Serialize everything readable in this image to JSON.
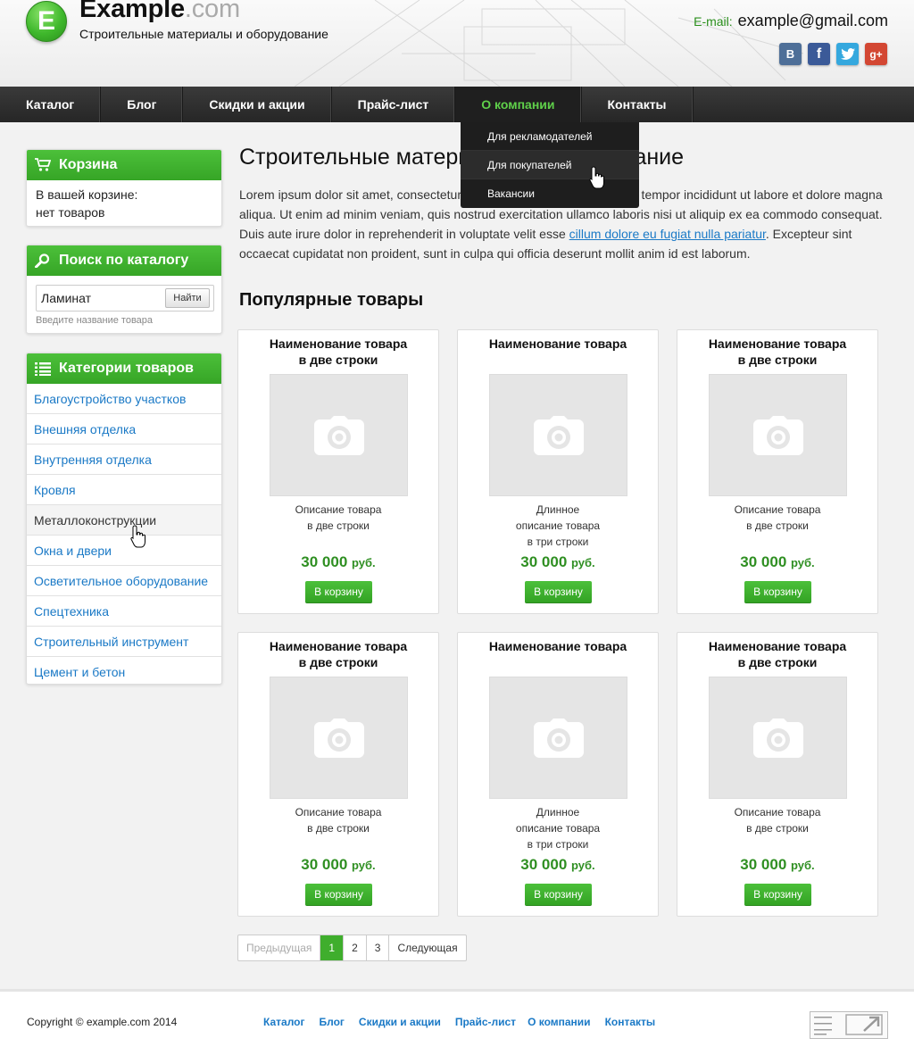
{
  "header": {
    "logo_letter": "E",
    "site_name": "Example",
    "site_domain": ".com",
    "tagline": "Строительные материалы и оборудование",
    "email_label": "E-mail:",
    "email": "example@gmail.com",
    "social": [
      "vk-icon",
      "facebook-icon",
      "twitter-icon",
      "google-plus-icon"
    ]
  },
  "nav": {
    "items": [
      "Каталог",
      "Блог",
      "Скидки и акции",
      "Прайс-лист",
      "О компании",
      "Контакты"
    ],
    "active": "О компании",
    "dropdown": [
      "Для рекламодателей",
      "Для покупателей",
      "Вакансии"
    ],
    "dropdown_hover": "Для покупателей"
  },
  "sidebar": {
    "cart": {
      "title": "Корзина",
      "line1": "В вашей корзине:",
      "line2": "нет товаров"
    },
    "search": {
      "title": "Поиск по каталогу",
      "value": "Ламинат",
      "button": "Найти",
      "hint": "Введите название товара"
    },
    "categories": {
      "title": "Категории товаров",
      "items": [
        "Благоустройство участков",
        "Внешняя отделка",
        "Внутренняя отделка",
        "Кровля",
        "Металлоконструкции",
        "Окна и двери",
        "Осветительное оборудование",
        "Спецтехника",
        "Строительный инструмент",
        "Цемент и бетон"
      ],
      "hover": "Металлоконструкции"
    }
  },
  "main": {
    "title": "Строительные материалы и оборудование",
    "intro_before": "Lorem ipsum dolor sit amet, consectetur adipisicing elit, sed do eiusmod tempor incididunt ut labore et dolore magna aliqua. Ut enim ad minim veniam, quis nostrud exercitation ullamco laboris nisi ut aliquip ex ea commodo consequat. Duis aute irure dolor in reprehenderit in voluptate velit esse ",
    "intro_link": "cillum dolore eu fugiat nulla pariatur",
    "intro_after": ". Excepteur sint occaecat cupidatat non proident, sunt in culpa qui officia deserunt mollit anim id est laborum.",
    "popular_title": "Популярные товары",
    "products": [
      {
        "title": "Наименование товара\nв две строки",
        "desc": "Описание товара\nв две строки",
        "price": "30 000",
        "currency": "руб.",
        "button": "В корзину"
      },
      {
        "title": "Наименование товара",
        "desc": "Длинное\nописание товара\nв три строки",
        "price": "30 000",
        "currency": "руб.",
        "button": "В корзину"
      },
      {
        "title": "Наименование товара\nв две строки",
        "desc": "Описание товара\nв две строки",
        "price": "30 000",
        "currency": "руб.",
        "button": "В корзину"
      },
      {
        "title": "Наименование товара\nв две строки",
        "desc": "Описание товара\nв две строки",
        "price": "30 000",
        "currency": "руб.",
        "button": "В корзину"
      },
      {
        "title": "Наименование товара",
        "desc": "Длинное\nописание товара\nв три строки",
        "price": "30 000",
        "currency": "руб.",
        "button": "В корзину"
      },
      {
        "title": "Наименование товара\nв две строки",
        "desc": "Описание товара\nв две строки",
        "price": "30 000",
        "currency": "руб.",
        "button": "В корзину"
      }
    ],
    "pagination": {
      "prev": "Предыдущая",
      "pages": [
        "1",
        "2",
        "3"
      ],
      "current": "1",
      "next": "Следующая"
    }
  },
  "footer": {
    "copyright": "Copyright © example.com 2014",
    "links": [
      "Каталог",
      "Блог",
      "Скидки и акции",
      "Прайс-лист",
      "О компании",
      "Контакты"
    ]
  },
  "colors": {
    "accent_green": "#3fae2d",
    "link_blue": "#1a79c6",
    "nav_dark": "#2a2a2a"
  }
}
